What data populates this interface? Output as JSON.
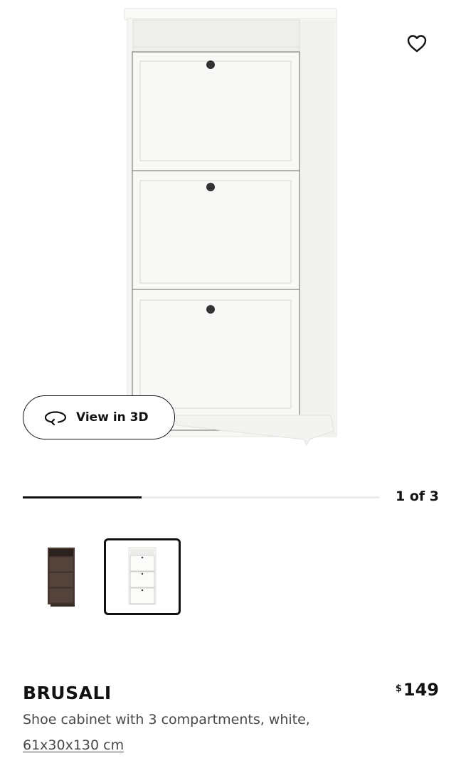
{
  "gallery": {
    "favorite_icon": "heart-outline-icon",
    "view_3d": {
      "icon": "rotate-3d-icon",
      "label": "View in 3D"
    },
    "progress": {
      "current": 1,
      "total": 3,
      "fraction": 0.333,
      "label": "1 of 3"
    },
    "thumbnails": [
      {
        "variant": "brown",
        "selected": false
      },
      {
        "variant": "white",
        "selected": true
      }
    ]
  },
  "product": {
    "name": "BRUSALI",
    "price": {
      "currency": "$",
      "amount": "149"
    },
    "description": "Shoe cabinet with 3 compartments, white,",
    "dimensions": "61x30x130 cm"
  },
  "colors": {
    "text": "#111111",
    "secondary_text": "#484848",
    "cabinet_white": "#f7f7f5",
    "cabinet_brown": "#4a3a33"
  }
}
